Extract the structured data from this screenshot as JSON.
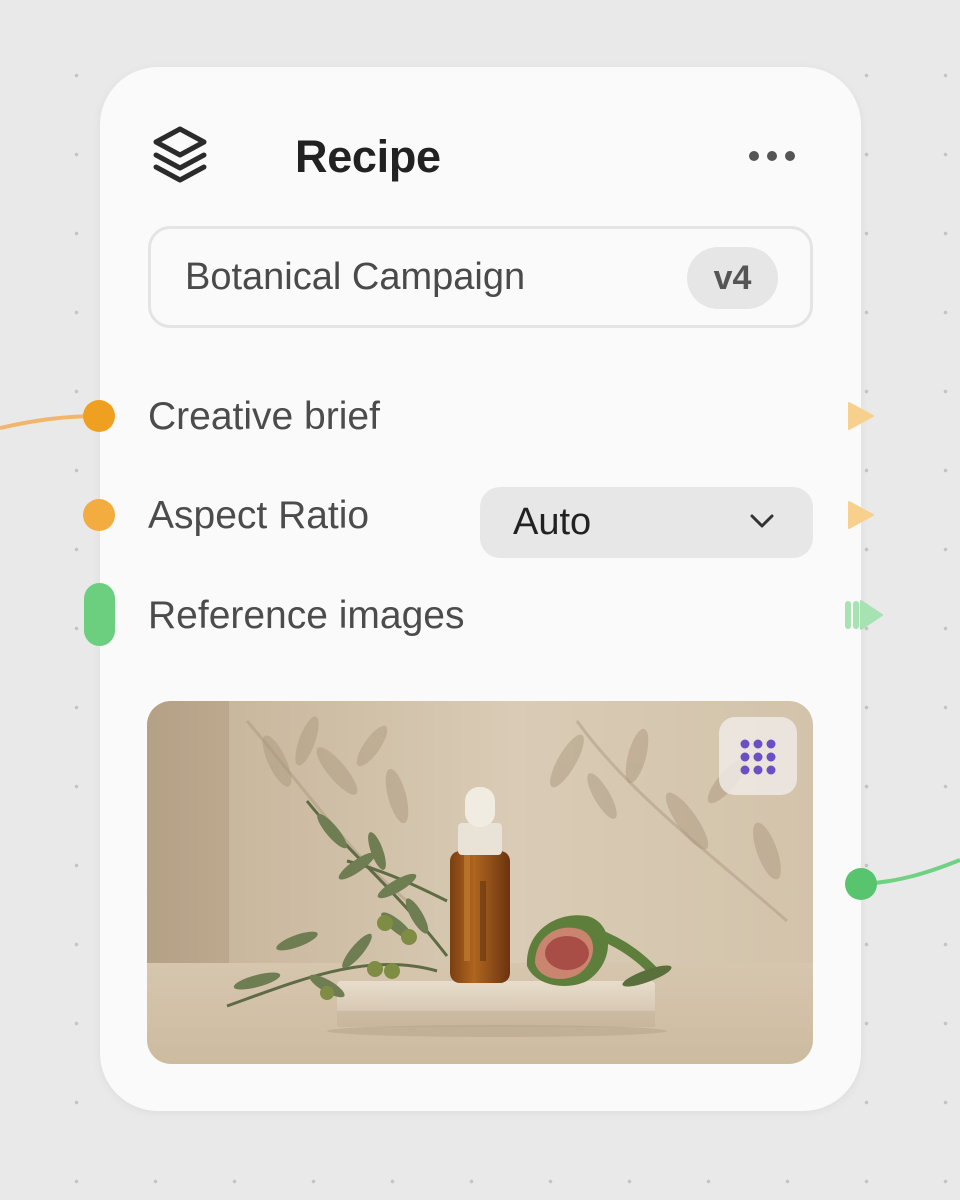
{
  "node": {
    "title": "Recipe",
    "icon": "layers-icon",
    "menu_icon": "more-horizontal-icon"
  },
  "recipe": {
    "name": "Botanical Campaign",
    "version": "v4"
  },
  "inputs": [
    {
      "label": "Creative brief",
      "port_color": "#f0a020"
    },
    {
      "label": "Aspect Ratio",
      "port_color": "#f3ac3f"
    },
    {
      "label": "Reference images",
      "port_color": "#6ccf7f"
    }
  ],
  "aspect_select": {
    "value": "Auto",
    "icon": "chevron-down-icon"
  },
  "preview": {
    "icon": "grid-icon"
  },
  "colors": {
    "orange": "#f0a020",
    "green": "#62c978",
    "accent_purple": "#6b4fc4"
  }
}
